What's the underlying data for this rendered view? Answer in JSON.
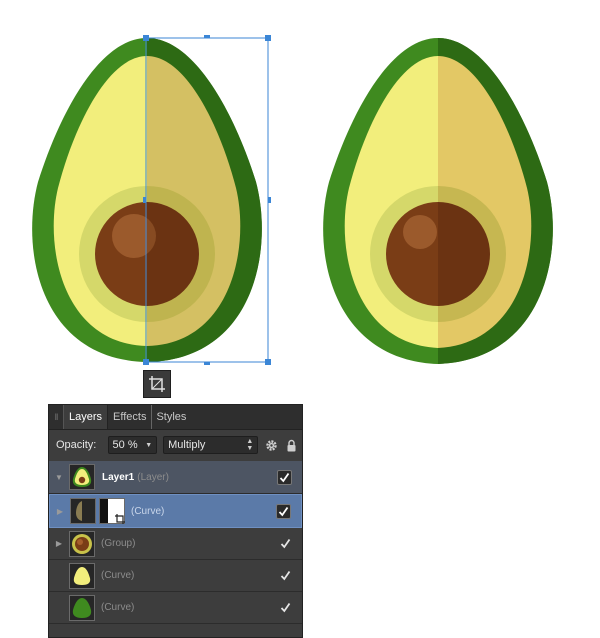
{
  "crop_tool": {
    "icon": "crop-icon"
  },
  "panel": {
    "tabs": [
      {
        "label": "Layers",
        "active": true
      },
      {
        "label": "Effects",
        "active": false
      },
      {
        "label": "Styles",
        "active": false
      }
    ],
    "opacity_label": "Opacity:",
    "opacity_value": "50 %",
    "blend_mode": "Multiply",
    "layers": [
      {
        "name": "Layer1",
        "type": "(Layer)",
        "visible": true
      },
      {
        "name": "",
        "type": "(Curve)",
        "visible": true
      },
      {
        "name": "",
        "type": "(Group)",
        "visible": true
      },
      {
        "name": "",
        "type": "(Curve)",
        "visible": true
      },
      {
        "name": "",
        "type": "(Curve)",
        "visible": true
      }
    ]
  },
  "colors": {
    "avocado_rim": "#3f8a1f",
    "avocado_rim_shade": "#33701a",
    "flesh": "#f2ee7c",
    "flesh_shade": "#e4c867",
    "pit_ring": "#d5d86a",
    "pit": "#7a3d16",
    "selection": "#3b86d6",
    "panel_bg": "#3d3d3d",
    "selected_row": "#5b7aa8"
  }
}
